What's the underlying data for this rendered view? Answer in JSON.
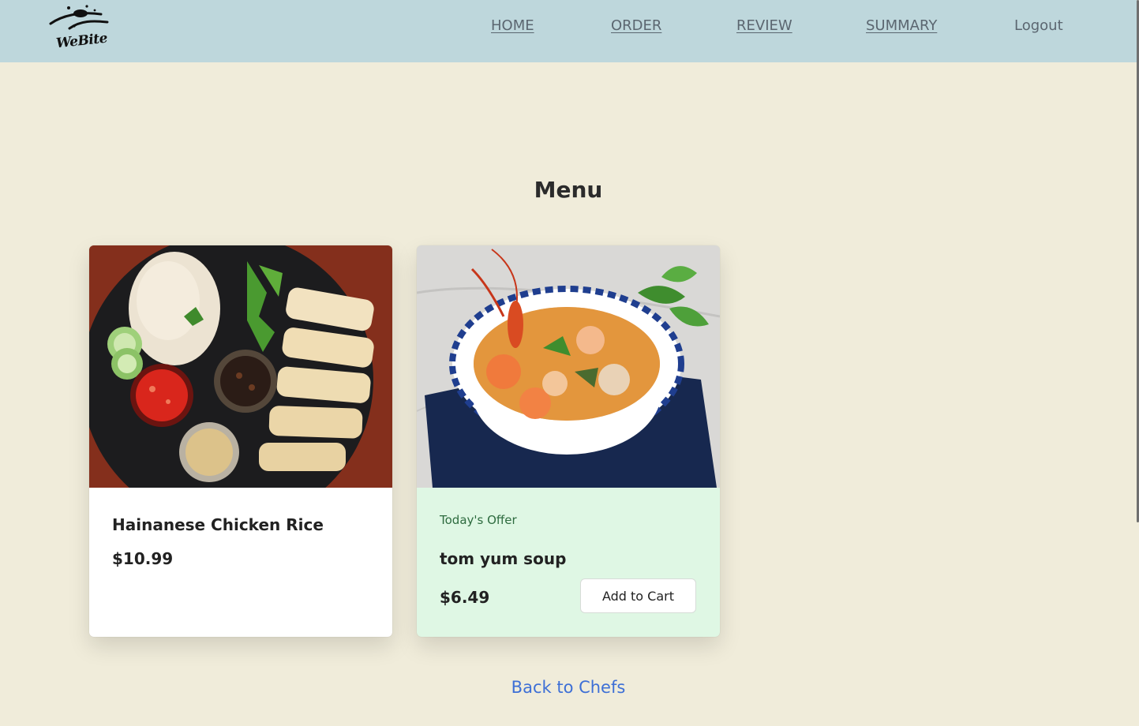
{
  "brand": {
    "logo_text": "WeBite"
  },
  "nav": {
    "home": "HOME",
    "order": "ORDER",
    "review": "REVIEW",
    "summary": "SUMMARY",
    "logout": "Logout"
  },
  "page": {
    "title": "Menu"
  },
  "menu": {
    "items": [
      {
        "name": "Hainanese Chicken Rice",
        "price": "$10.99",
        "image_icon": "chicken-rice-photo"
      },
      {
        "offer_label": "Today's Offer",
        "name": "tom yum soup",
        "price": "$6.49",
        "button": "Add to Cart",
        "image_icon": "tom-yum-soup-photo"
      }
    ]
  },
  "footer": {
    "back_link": "Back to Chefs"
  },
  "colors": {
    "navbar": "#bed7dc",
    "background": "#f0ecda",
    "offer_card": "#dff7e4",
    "link": "#3d6fd6"
  }
}
